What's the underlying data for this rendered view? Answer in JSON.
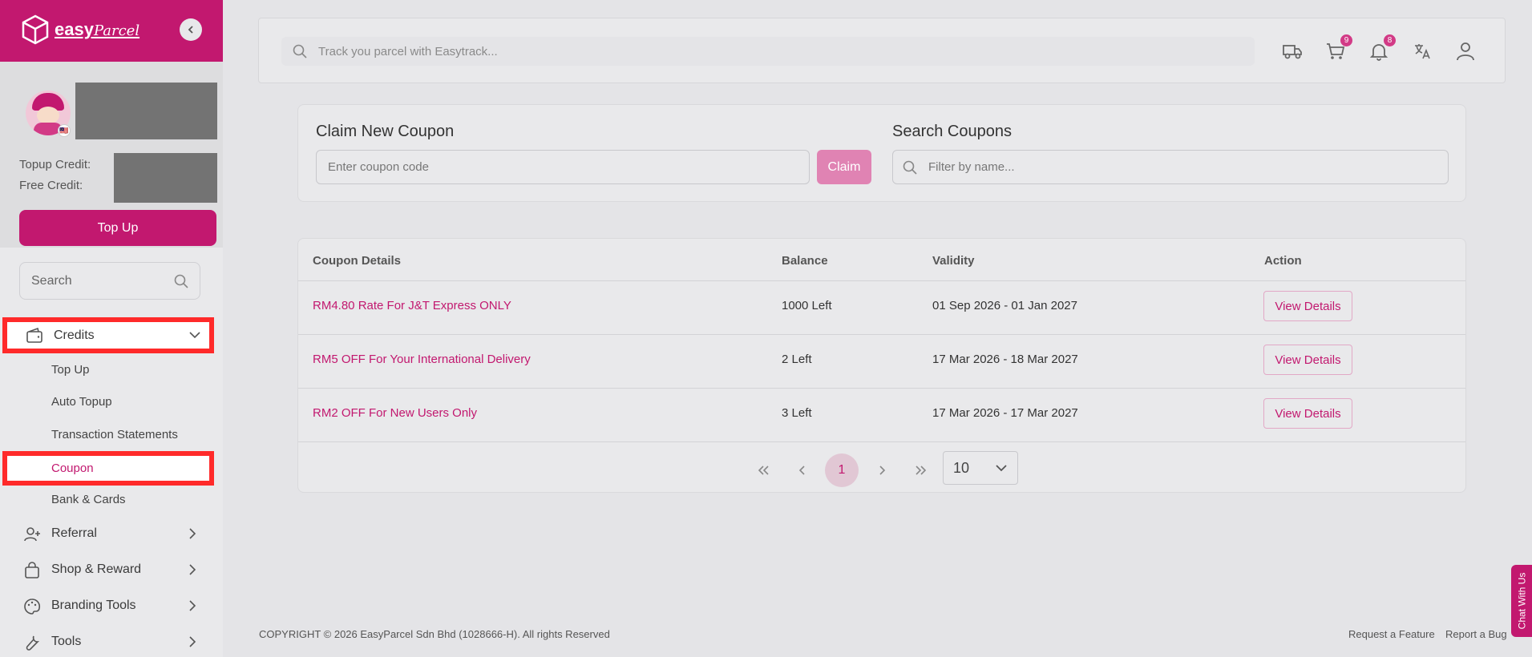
{
  "brand": {
    "name": "easy",
    "name_script": "Parcel",
    "accent": "#c2186f"
  },
  "profile": {
    "topup_credit_label": "Topup Credit:",
    "free_credit_label": "Free Credit:",
    "topup_button": "Top Up",
    "flag": "🇲🇾"
  },
  "sidebar": {
    "search_placeholder": "Search",
    "credits": {
      "label": "Credits",
      "sub_items": [
        {
          "label": "Top Up"
        },
        {
          "label": "Auto Topup"
        },
        {
          "label": "Transaction Statements"
        },
        {
          "label": "Coupon",
          "active": true
        },
        {
          "label": "Bank & Cards"
        }
      ]
    },
    "items": [
      {
        "label": "Referral",
        "icon": "user-plus-icon"
      },
      {
        "label": "Shop & Reward",
        "icon": "shopping-bag-icon"
      },
      {
        "label": "Branding Tools",
        "icon": "palette-icon"
      },
      {
        "label": "Tools",
        "icon": "wrench-icon"
      }
    ]
  },
  "header": {
    "track_placeholder": "Track you parcel with Easytrack...",
    "cart_count": "9",
    "notification_count": "8"
  },
  "claim": {
    "title": "Claim New Coupon",
    "input_placeholder": "Enter coupon code",
    "button": "Claim"
  },
  "search_coupons": {
    "title": "Search Coupons",
    "placeholder": "Filter by name..."
  },
  "table": {
    "columns": [
      "Coupon Details",
      "Balance",
      "Validity",
      "Action"
    ],
    "rows": [
      {
        "name": "RM4.80 Rate For J&T Express ONLY",
        "balance": "1000 Left",
        "validity": "01 Sep 2026 - 01 Jan 2027",
        "action": "View Details"
      },
      {
        "name": "RM5 OFF For Your International Delivery",
        "balance": "2 Left",
        "validity": "17 Mar 2026 - 18 Mar 2027",
        "action": "View Details"
      },
      {
        "name": "RM2 OFF For New Users Only",
        "balance": "3 Left",
        "validity": "17 Mar 2026 - 17 Mar 2027",
        "action": "View Details"
      }
    ]
  },
  "pagination": {
    "current_page": "1",
    "page_size": "10"
  },
  "footer": {
    "copyright": "COPYRIGHT © 2026 EasyParcel Sdn Bhd (1028666-H). All rights Reserved",
    "request_feature": "Request a Feature",
    "report_bug": "Report a Bug"
  },
  "chat": {
    "label": "Chat With Us"
  }
}
